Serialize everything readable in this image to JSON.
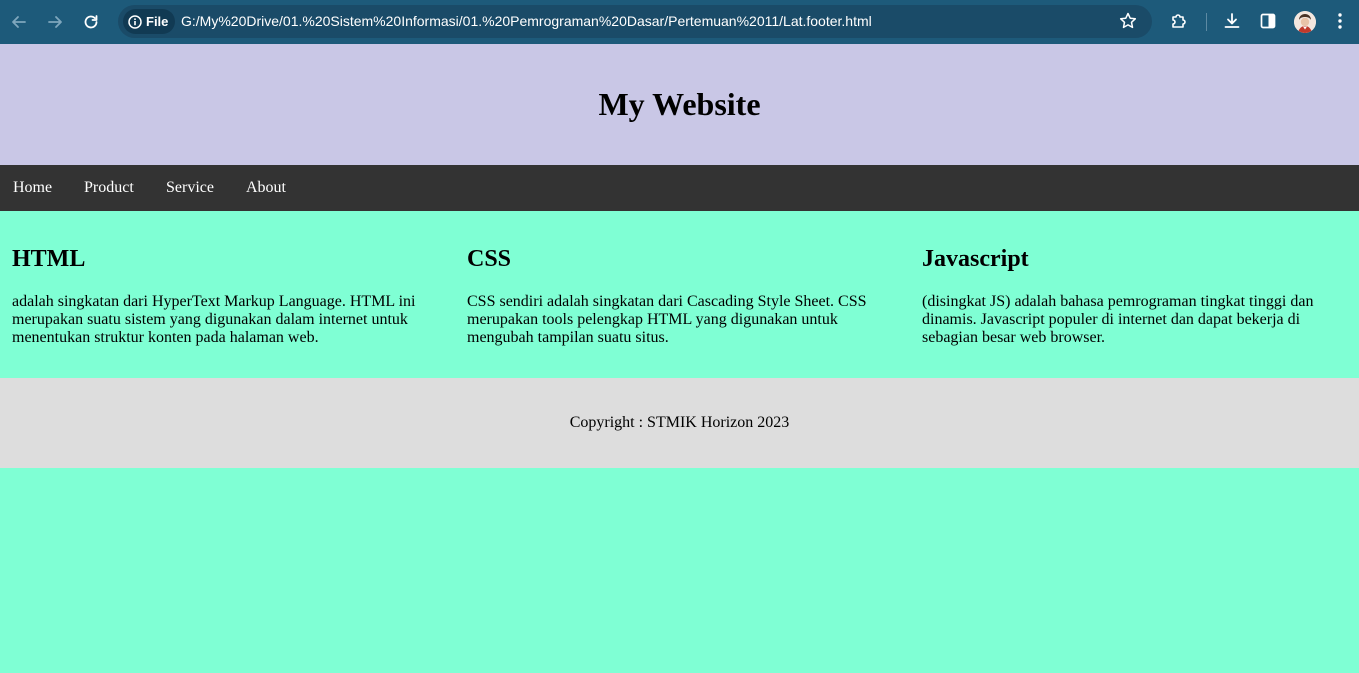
{
  "browser": {
    "site_chip_label": "File",
    "url": "G:/My%20Drive/01.%20Sistem%20Informasi/01.%20Pemrograman%20Dasar/Pertemuan%2011/Lat.footer.html"
  },
  "header": {
    "title": "My Website"
  },
  "nav": {
    "items": [
      {
        "label": "Home"
      },
      {
        "label": "Product"
      },
      {
        "label": "Service"
      },
      {
        "label": "About"
      }
    ]
  },
  "columns": [
    {
      "heading": "HTML",
      "text": "adalah singkatan dari HyperText Markup Language. HTML ini merupakan suatu sistem yang digunakan dalam internet untuk menentukan struktur konten pada halaman web."
    },
    {
      "heading": "CSS",
      "text": "CSS sendiri adalah singkatan dari Cascading Style Sheet. CSS merupakan tools pelengkap HTML yang digunakan untuk mengubah tampilan suatu situs."
    },
    {
      "heading": "Javascript",
      "text": "(disingkat JS) adalah bahasa pemrograman tingkat tinggi dan dinamis. Javascript populer di internet dan dapat bekerja di sebagian besar web browser."
    }
  ],
  "footer": {
    "text": "Copyright : STMIK Horizon 2023"
  },
  "colors": {
    "browser_bar": "#1d5a7a",
    "header_bg": "#c9c7e6",
    "nav_bg": "#333333",
    "content_bg": "#7fffd4",
    "footer_bg": "#dddddd"
  },
  "icons": {
    "back": "arrow-left-icon",
    "forward": "arrow-right-icon",
    "reload": "reload-icon",
    "info": "info-icon",
    "star": "star-icon",
    "extensions": "puzzle-icon",
    "download": "download-icon",
    "side_panel": "side-panel-icon",
    "profile": "avatar",
    "menu": "kebab-menu-icon"
  }
}
